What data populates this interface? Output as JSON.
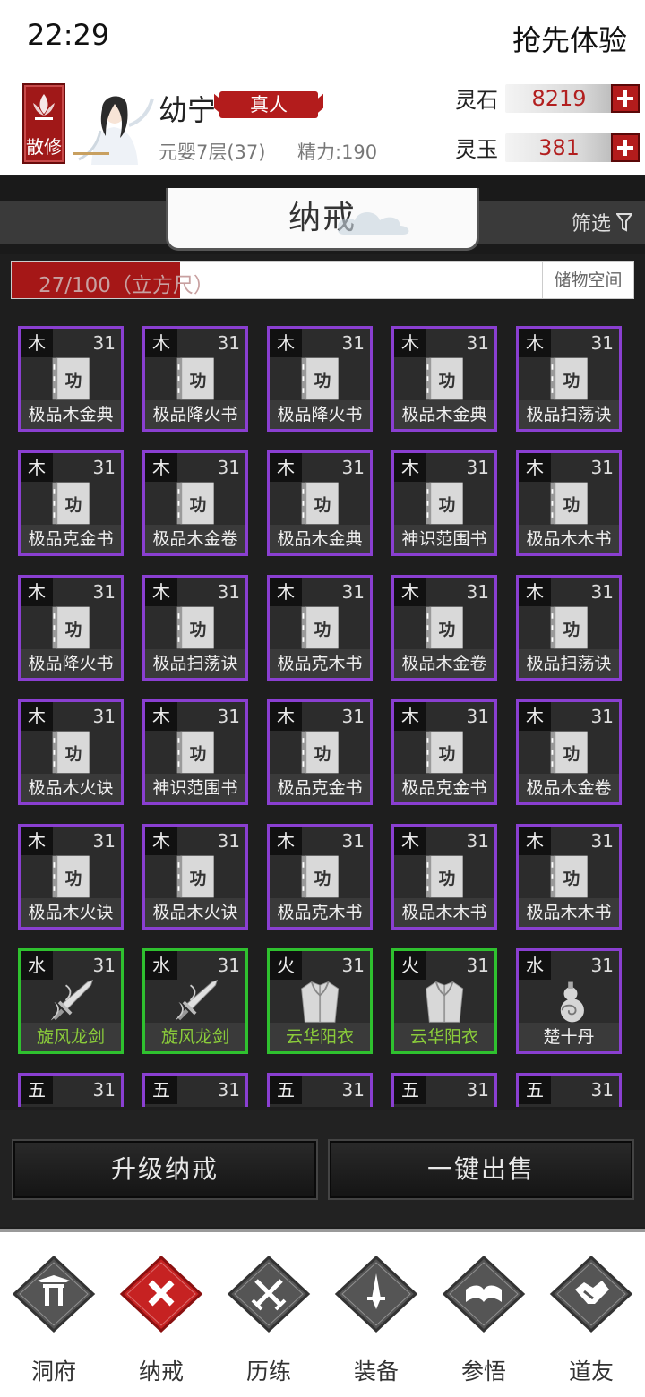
{
  "status": {
    "time": "22:29",
    "right_text": "抢先体验"
  },
  "player": {
    "sect_label": "散修",
    "name": "幼宁",
    "rank": "真人",
    "realm": "元婴7层(37)",
    "energy": "精力:190"
  },
  "resources": [
    {
      "label": "灵石",
      "value": "8219"
    },
    {
      "label": "灵玉",
      "value": "381"
    }
  ],
  "tab": {
    "title": "纳戒",
    "filter_label": "筛选"
  },
  "capacity": {
    "text": "27/100（立方尺）",
    "used": 27,
    "max": 100,
    "storage_label": "储物空间"
  },
  "items": [
    {
      "elem": "木",
      "lvl": "31",
      "name": "极品木金典",
      "icon": "book-icon",
      "rarity": "purple"
    },
    {
      "elem": "木",
      "lvl": "31",
      "name": "极品降火书",
      "icon": "book-icon",
      "rarity": "purple"
    },
    {
      "elem": "木",
      "lvl": "31",
      "name": "极品降火书",
      "icon": "book-icon",
      "rarity": "purple"
    },
    {
      "elem": "木",
      "lvl": "31",
      "name": "极品木金典",
      "icon": "book-icon",
      "rarity": "purple"
    },
    {
      "elem": "木",
      "lvl": "31",
      "name": "极品扫荡诀",
      "icon": "book-icon",
      "rarity": "purple"
    },
    {
      "elem": "木",
      "lvl": "31",
      "name": "极品克金书",
      "icon": "book-icon",
      "rarity": "purple"
    },
    {
      "elem": "木",
      "lvl": "31",
      "name": "极品木金卷",
      "icon": "book-icon",
      "rarity": "purple"
    },
    {
      "elem": "木",
      "lvl": "31",
      "name": "极品木金典",
      "icon": "book-icon",
      "rarity": "purple"
    },
    {
      "elem": "木",
      "lvl": "31",
      "name": "神识范围书",
      "icon": "book-icon",
      "rarity": "purple"
    },
    {
      "elem": "木",
      "lvl": "31",
      "name": "极品木木书",
      "icon": "book-icon",
      "rarity": "purple"
    },
    {
      "elem": "木",
      "lvl": "31",
      "name": "极品降火书",
      "icon": "book-icon",
      "rarity": "purple"
    },
    {
      "elem": "木",
      "lvl": "31",
      "name": "极品扫荡诀",
      "icon": "book-icon",
      "rarity": "purple"
    },
    {
      "elem": "木",
      "lvl": "31",
      "name": "极品克木书",
      "icon": "book-icon",
      "rarity": "purple"
    },
    {
      "elem": "木",
      "lvl": "31",
      "name": "极品木金卷",
      "icon": "book-icon",
      "rarity": "purple"
    },
    {
      "elem": "木",
      "lvl": "31",
      "name": "极品扫荡诀",
      "icon": "book-icon",
      "rarity": "purple"
    },
    {
      "elem": "木",
      "lvl": "31",
      "name": "极品木火诀",
      "icon": "book-icon",
      "rarity": "purple"
    },
    {
      "elem": "木",
      "lvl": "31",
      "name": "神识范围书",
      "icon": "book-icon",
      "rarity": "purple"
    },
    {
      "elem": "木",
      "lvl": "31",
      "name": "极品克金书",
      "icon": "book-icon",
      "rarity": "purple"
    },
    {
      "elem": "木",
      "lvl": "31",
      "name": "极品克金书",
      "icon": "book-icon",
      "rarity": "purple"
    },
    {
      "elem": "木",
      "lvl": "31",
      "name": "极品木金卷",
      "icon": "book-icon",
      "rarity": "purple"
    },
    {
      "elem": "木",
      "lvl": "31",
      "name": "极品木火诀",
      "icon": "book-icon",
      "rarity": "purple"
    },
    {
      "elem": "木",
      "lvl": "31",
      "name": "极品木火诀",
      "icon": "book-icon",
      "rarity": "purple"
    },
    {
      "elem": "木",
      "lvl": "31",
      "name": "极品克木书",
      "icon": "book-icon",
      "rarity": "purple"
    },
    {
      "elem": "木",
      "lvl": "31",
      "name": "极品木木书",
      "icon": "book-icon",
      "rarity": "purple"
    },
    {
      "elem": "木",
      "lvl": "31",
      "name": "极品木木书",
      "icon": "book-icon",
      "rarity": "purple"
    },
    {
      "elem": "水",
      "lvl": "31",
      "name": "旋风龙剑",
      "icon": "sword-icon",
      "rarity": "green"
    },
    {
      "elem": "水",
      "lvl": "31",
      "name": "旋风龙剑",
      "icon": "sword-icon",
      "rarity": "green"
    },
    {
      "elem": "火",
      "lvl": "31",
      "name": "云华阳衣",
      "icon": "robe-icon",
      "rarity": "green"
    },
    {
      "elem": "火",
      "lvl": "31",
      "name": "云华阳衣",
      "icon": "robe-icon",
      "rarity": "green"
    },
    {
      "elem": "水",
      "lvl": "31",
      "name": "楚十丹",
      "icon": "gourd-icon",
      "rarity": "purple"
    },
    {
      "elem": "五",
      "lvl": "31",
      "name": "",
      "icon": "item-icon",
      "rarity": "purple"
    },
    {
      "elem": "五",
      "lvl": "31",
      "name": "",
      "icon": "item-icon",
      "rarity": "purple"
    },
    {
      "elem": "五",
      "lvl": "31",
      "name": "",
      "icon": "item-icon",
      "rarity": "purple"
    },
    {
      "elem": "五",
      "lvl": "31",
      "name": "",
      "icon": "item-icon",
      "rarity": "purple"
    },
    {
      "elem": "五",
      "lvl": "31",
      "name": "",
      "icon": "item-icon",
      "rarity": "purple"
    }
  ],
  "actions": {
    "upgrade_label": "升级纳戒",
    "sell_label": "一键出售"
  },
  "nav": [
    {
      "label": "洞府",
      "icon": "gate-icon",
      "active": false
    },
    {
      "label": "纳戒",
      "icon": "ring-icon",
      "active": true
    },
    {
      "label": "历练",
      "icon": "crossed-swords-icon",
      "active": false
    },
    {
      "label": "装备",
      "icon": "dagger-icon",
      "active": false
    },
    {
      "label": "参悟",
      "icon": "open-book-icon",
      "active": false
    },
    {
      "label": "道友",
      "icon": "handshake-icon",
      "active": false
    }
  ],
  "colors": {
    "accent_red": "#b31c1c",
    "rare_purple": "#8a3fd1",
    "uncommon_green": "#2fc12f"
  }
}
